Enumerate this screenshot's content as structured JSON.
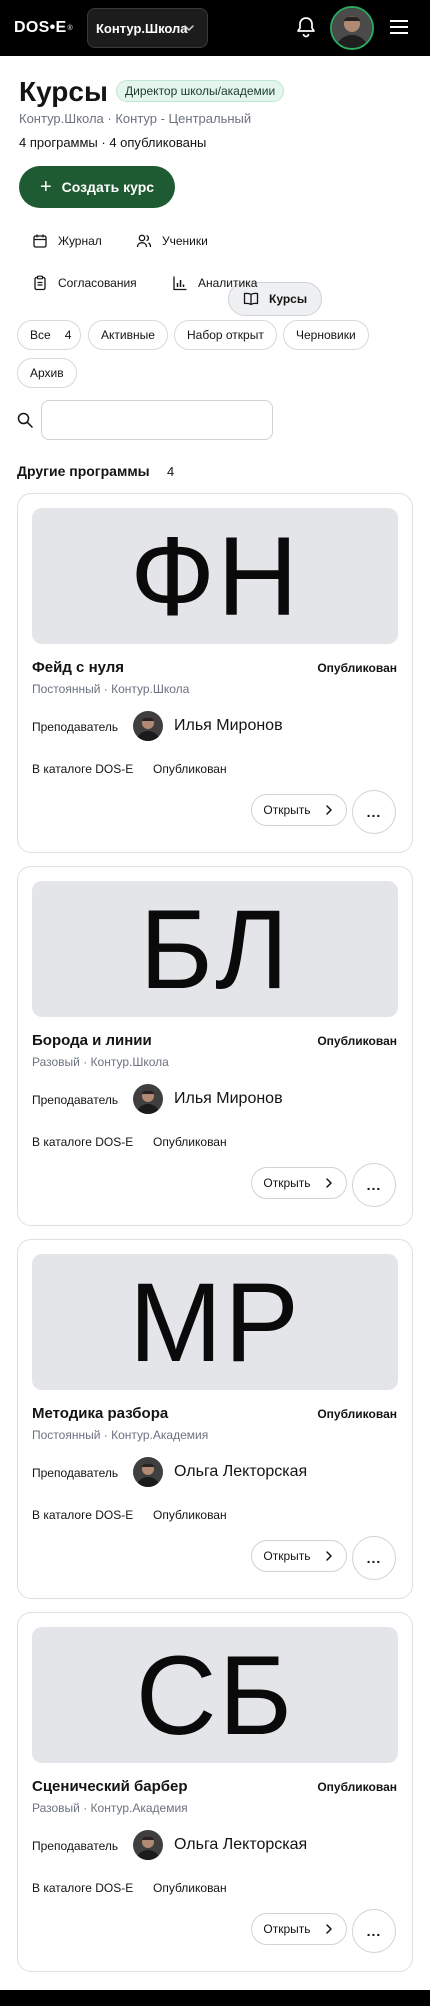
{
  "header": {
    "logo_text": "DOS•E",
    "logo_tm": "®",
    "school_select": "Контур.Школа",
    "icons": {
      "school_select": "chevron-down-icon",
      "notifications": "bell-icon",
      "menu": "hamburger-menu-icon"
    }
  },
  "page": {
    "title": "Курсы",
    "role_badge": "Директор школы/академии",
    "breadcrumb": "Контур.Школа · Контур - Центральный",
    "stats": "4 программы · 4 опубликованы",
    "create_button": "Создать курс"
  },
  "nav": {
    "tabs": [
      {
        "label": "Журнал",
        "icon": "calendar-icon",
        "active": false
      },
      {
        "label": "Ученики",
        "icon": "users-icon",
        "active": false
      },
      {
        "label": "Курсы",
        "icon": "book-icon",
        "active": true
      },
      {
        "label": "Согласования",
        "icon": "clipboard-icon",
        "active": false
      },
      {
        "label": "Аналитика",
        "icon": "bar-chart-icon",
        "active": false
      }
    ]
  },
  "filters": {
    "chips": [
      {
        "label": "Все",
        "count": "4"
      },
      {
        "label": "Активные"
      },
      {
        "label": "Набор открыт"
      },
      {
        "label": "Черновики"
      },
      {
        "label": "Архив"
      }
    ]
  },
  "search": {
    "placeholder": "",
    "value": ""
  },
  "section": {
    "title": "Другие программы",
    "count": "4"
  },
  "cards": [
    {
      "initials": "ФН",
      "title": "Фейд с нуля",
      "status": "Опубликован",
      "meta": "Постоянный · Контур.Школа",
      "teacher_label": "Преподаватель",
      "teacher": "Илья Миронов",
      "catalog_label": "В каталоге DOS-E",
      "catalog_value": "Опубликован",
      "open_label": "Открыть",
      "more_label": "..."
    },
    {
      "initials": "БЛ",
      "title": "Борода и линии",
      "status": "Опубликован",
      "meta": "Разовый · Контур.Школа",
      "teacher_label": "Преподаватель",
      "teacher": "Илья Миронов",
      "catalog_label": "В каталоге DOS-E",
      "catalog_value": "Опубликован",
      "open_label": "Открыть",
      "more_label": "..."
    },
    {
      "initials": "МР",
      "title": "Методика разбора",
      "status": "Опубликован",
      "meta": "Постоянный · Контур.Академия",
      "teacher_label": "Преподаватель",
      "teacher": "Ольга Лекторская",
      "catalog_label": "В каталоге DOS-E",
      "catalog_value": "Опубликован",
      "open_label": "Открыть",
      "more_label": "..."
    },
    {
      "initials": "СБ",
      "title": "Сценический барбер",
      "status": "Опубликован",
      "meta": "Разовый · Контур.Академия",
      "teacher_label": "Преподаватель",
      "teacher": "Ольга Лекторская",
      "catalog_label": "В каталоге DOS-E",
      "catalog_value": "Опубликован",
      "open_label": "Открыть",
      "more_label": "..."
    }
  ]
}
